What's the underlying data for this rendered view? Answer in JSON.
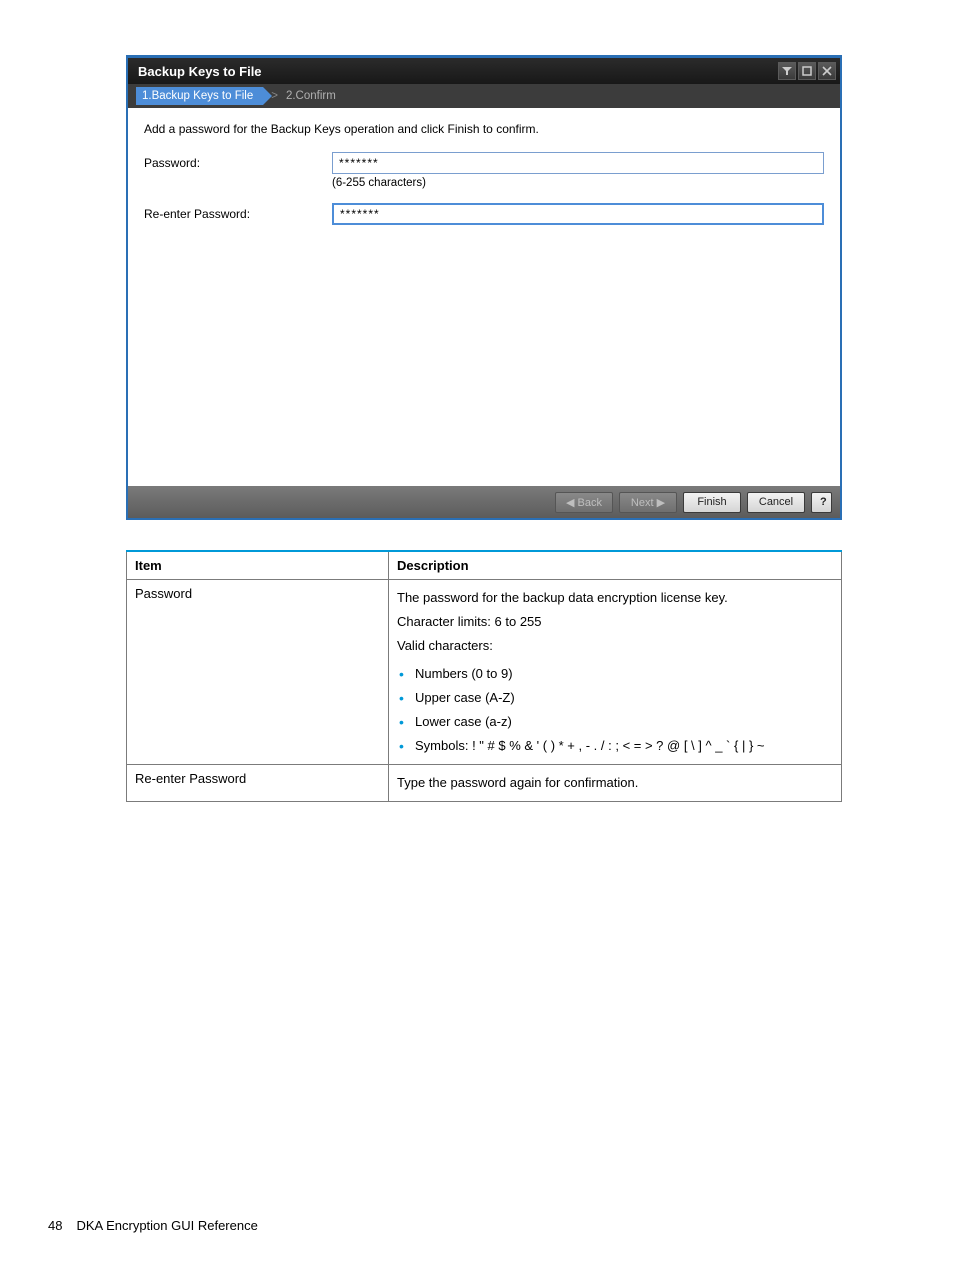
{
  "dialog": {
    "title": "Backup Keys to File",
    "steps": {
      "active": "1.Backup Keys to File",
      "next": "2.Confirm"
    },
    "instruction": "Add a password for the Backup Keys operation and click Finish to confirm.",
    "password_label": "Password:",
    "password_value": "*******",
    "password_hint": "(6-255 characters)",
    "reenter_label": "Re-enter Password:",
    "reenter_value": "*******",
    "buttons": {
      "back": "◀ Back",
      "next": "Next ▶",
      "finish": "Finish",
      "cancel": "Cancel",
      "help": "?"
    }
  },
  "table": {
    "headers": {
      "item": "Item",
      "description": "Description"
    },
    "rows": [
      {
        "item": "Password",
        "desc_lines": [
          "The password for the backup data encryption license key.",
          "Character limits: 6 to 255",
          "Valid characters:"
        ],
        "bullets": [
          "Numbers (0 to 9)",
          "Upper case (A-Z)",
          "Lower case (a-z)",
          "Symbols: ! \" # $ % & ' ( ) * + , - . / : ; < = > ? @ [ \\ ] ^ _ ` { | } ~"
        ]
      },
      {
        "item": "Re-enter Password",
        "desc_lines": [
          "Type the password again for confirmation."
        ],
        "bullets": []
      }
    ]
  },
  "footer": {
    "page": "48",
    "section": "DKA Encryption GUI Reference"
  }
}
